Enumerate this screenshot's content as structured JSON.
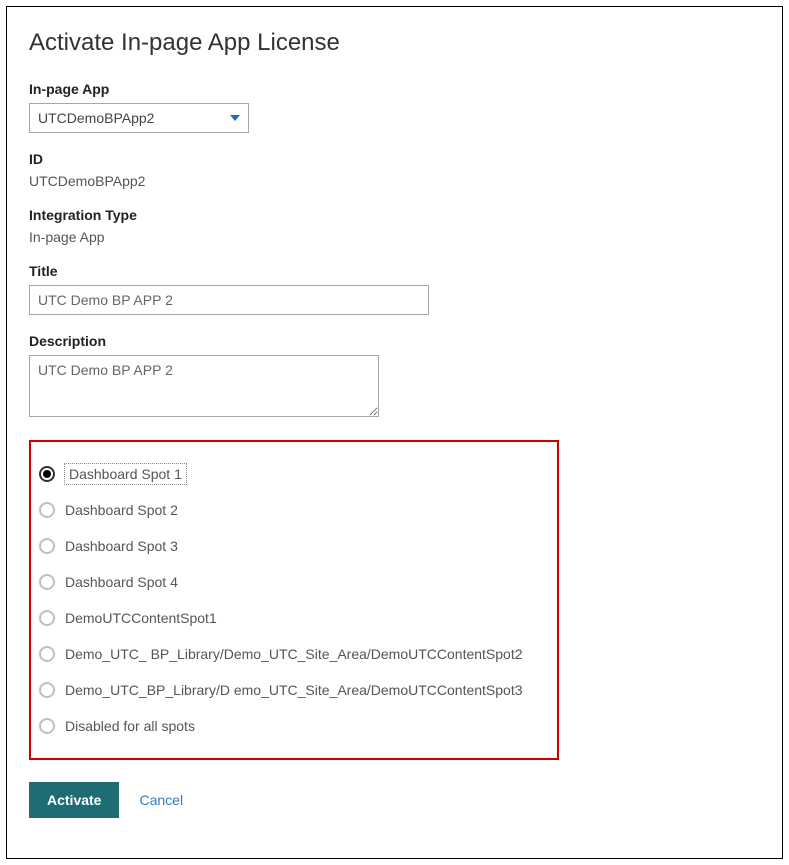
{
  "page_title": "Activate In-page App License",
  "fields": {
    "inpage_app": {
      "label": "In-page App",
      "value": "UTCDemoBPApp2"
    },
    "id": {
      "label": "ID",
      "value": "UTCDemoBPApp2"
    },
    "integration_type": {
      "label": "Integration Type",
      "value": "In-page App"
    },
    "title": {
      "label": "Title",
      "value": "UTC Demo BP APP 2"
    },
    "description": {
      "label": "Description",
      "value": "UTC Demo BP APP 2"
    }
  },
  "radio_options": [
    {
      "label": "Dashboard Spot 1",
      "selected": true
    },
    {
      "label": "Dashboard Spot 2",
      "selected": false
    },
    {
      "label": "Dashboard Spot 3",
      "selected": false
    },
    {
      "label": "Dashboard Spot 4",
      "selected": false
    },
    {
      "label": "DemoUTCContentSpot1",
      "selected": false
    },
    {
      "label": "Demo_UTC_ BP_Library/Demo_UTC_Site_Area/DemoUTCContentSpot2",
      "selected": false
    },
    {
      "label": "Demo_UTC_BP_Library/D emo_UTC_Site_Area/DemoUTCContentSpot3",
      "selected": false
    },
    {
      "label": "Disabled for all spots",
      "selected": false
    }
  ],
  "buttons": {
    "activate": "Activate",
    "cancel": "Cancel"
  }
}
